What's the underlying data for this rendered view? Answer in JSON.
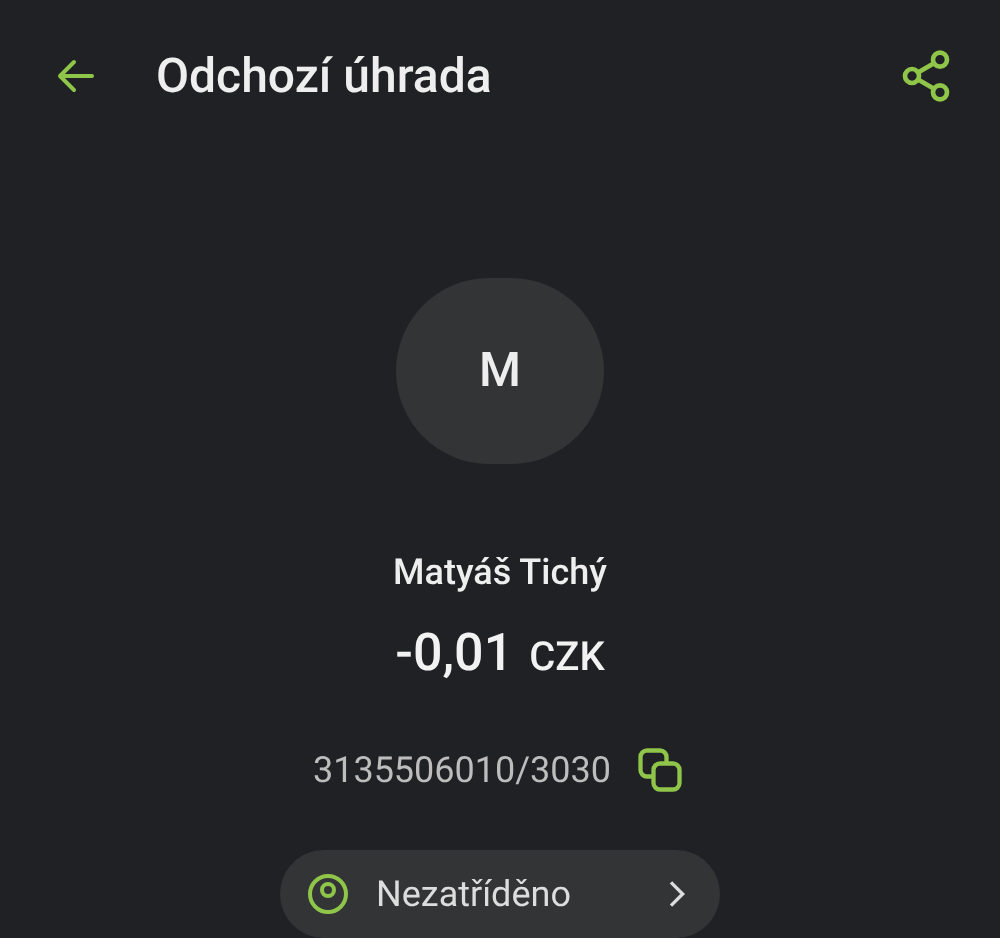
{
  "header": {
    "title": "Odchozí úhrada"
  },
  "counterparty": {
    "initial": "M",
    "name": "Matyáš Tichý",
    "amount": "-0,01",
    "currency": "CZK",
    "account": "3135506010/3030"
  },
  "category_chip": {
    "label": "Nezatříděno"
  }
}
